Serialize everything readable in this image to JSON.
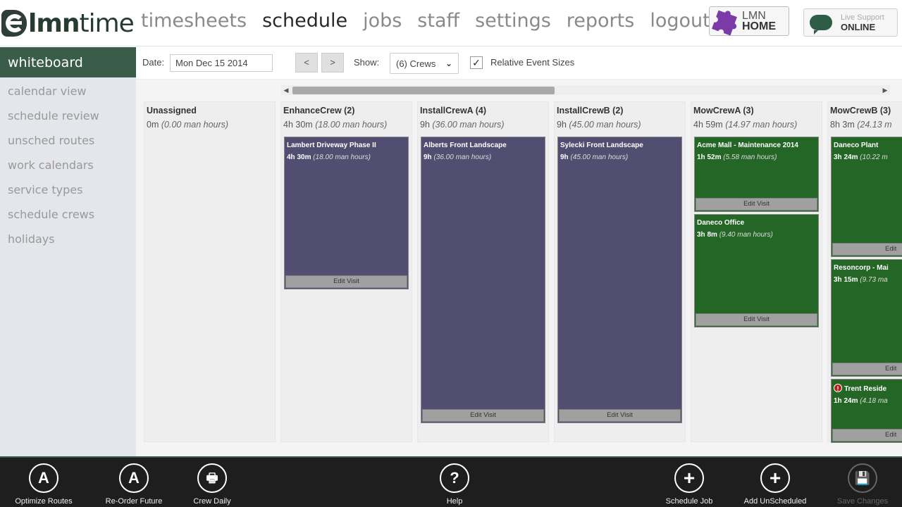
{
  "header": {
    "logo": {
      "bold": "lmn",
      "light": "time"
    },
    "nav": [
      {
        "label": "timesheets",
        "active": false
      },
      {
        "label": "schedule",
        "active": true
      },
      {
        "label": "jobs",
        "active": false
      },
      {
        "label": "staff",
        "active": false
      },
      {
        "label": "settings",
        "active": false
      },
      {
        "label": "reports",
        "active": false
      },
      {
        "label": "logout",
        "active": false
      }
    ],
    "lmn_home": {
      "line1": "LMN",
      "line2": "HOME"
    },
    "live_support": {
      "line1": "Live Support",
      "line2": "ONLINE"
    }
  },
  "sidebar": {
    "active": "whiteboard",
    "items": [
      "calendar view",
      "schedule review",
      "unsched routes",
      "work calendars",
      "service types",
      "schedule crews",
      "holidays"
    ]
  },
  "toolbar": {
    "date_label": "Date:",
    "date_value": "Mon Dec 15 2014",
    "prev": "<",
    "next": ">",
    "show_label": "Show:",
    "show_value": "(6) Crews",
    "relative_sizes_label": "Relative Event Sizes",
    "relative_sizes_checked": true
  },
  "board": {
    "edit_label": "Edit Visit",
    "columns": [
      {
        "title": "Unassigned",
        "hours": "0m",
        "man_hours": "(0.00 man hours)",
        "visits": []
      },
      {
        "title": "EnhanceCrew (2)",
        "hours": "4h 30m",
        "man_hours": "(18.00 man hours)",
        "visits": [
          {
            "name": "Lambert Driveway Phase II",
            "hours": "4h 30m",
            "man_hours": "(18.00 man hours)",
            "color": "purple",
            "warn": false
          }
        ]
      },
      {
        "title": "InstallCrewA (4)",
        "hours": "9h",
        "man_hours": "(36.00 man hours)",
        "visits": [
          {
            "name": "Alberts Front Landscape",
            "hours": "9h",
            "man_hours": "(36.00 man hours)",
            "color": "purple",
            "warn": false
          }
        ]
      },
      {
        "title": "InstallCrewB (2)",
        "hours": "9h",
        "man_hours": "(45.00 man hours)",
        "visits": [
          {
            "name": "Sylecki Front Landscape",
            "hours": "9h",
            "man_hours": "(45.00 man hours)",
            "color": "purple",
            "warn": false
          }
        ]
      },
      {
        "title": "MowCrewA (3)",
        "hours": "4h 59m",
        "man_hours": "(14.97 man hours)",
        "visits": [
          {
            "name": "Acme Mall - Maintenance 2014",
            "hours": "1h 52m",
            "man_hours": "(5.58 man hours)",
            "color": "green",
            "warn": false
          },
          {
            "name": "Daneco Office",
            "hours": "3h 8m",
            "man_hours": "(9.40 man hours)",
            "color": "green",
            "warn": false
          }
        ]
      },
      {
        "title": "MowCrewB (3)",
        "hours": "8h 3m",
        "man_hours": "(24.13 m",
        "visits": [
          {
            "name": "Daneco Plant",
            "hours": "3h 24m",
            "man_hours": "(10.22 m",
            "color": "green",
            "warn": false
          },
          {
            "name": "Resoncorp - Mai",
            "hours": "3h 15m",
            "man_hours": "(9.73 ma",
            "color": "green",
            "warn": false
          },
          {
            "name": "Trent Reside",
            "hours": "1h 24m",
            "man_hours": "(4.18 ma",
            "color": "green",
            "warn": true
          }
        ]
      }
    ]
  },
  "bottom_bar": [
    {
      "label": "Optimize Routes",
      "icon": "A",
      "icon_name": "optimize-routes-icon",
      "disabled": false
    },
    {
      "label": "Re-Order Future",
      "icon": "A",
      "icon_name": "reorder-future-icon",
      "disabled": false
    },
    {
      "label": "Crew Daily",
      "icon": "🖶",
      "icon_name": "printer-icon",
      "disabled": false
    },
    {
      "label": "Help",
      "icon": "?",
      "icon_name": "help-icon",
      "disabled": false
    },
    {
      "label": "Schedule Job",
      "icon": "+",
      "icon_name": "plus-icon",
      "disabled": false
    },
    {
      "label": "Add UnScheduled",
      "icon": "+",
      "icon_name": "plus-icon",
      "disabled": false
    },
    {
      "label": "Save Changes",
      "icon": "💾",
      "icon_name": "save-icon",
      "disabled": true
    }
  ],
  "colors": {
    "brand_green": "#3a5d4a",
    "visit_purple": "#524e71",
    "visit_green": "#246625"
  }
}
